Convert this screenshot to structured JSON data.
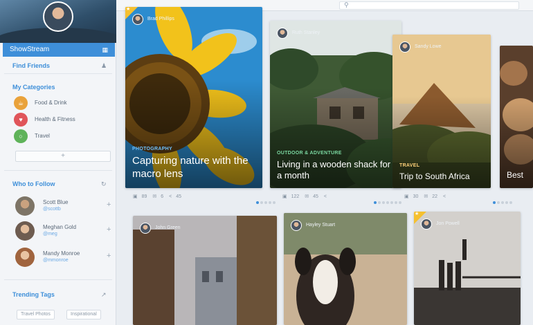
{
  "sidebar": {
    "stream_label": "ShowStream",
    "find_friends": "Find Friends",
    "my_categories": "My Categories",
    "categories": [
      {
        "label": "Food & Drink",
        "icon": "food-icon",
        "color": "#e9a23b"
      },
      {
        "label": "Health & Fitness",
        "icon": "heart-icon",
        "color": "#e0555a"
      },
      {
        "label": "Travel",
        "icon": "globe-icon",
        "color": "#5fb35a"
      }
    ],
    "add_label": "+",
    "who_to_follow": "Who to Follow",
    "follow": [
      {
        "name": "Scott Blue",
        "handle": "@scottb"
      },
      {
        "name": "Meghan Gold",
        "handle": "@meg"
      },
      {
        "name": "Mandy Monroe",
        "handle": "@mmonroe"
      }
    ],
    "trending_tags": "Trending Tags",
    "tags": [
      "Travel Photos",
      "Inspirational"
    ]
  },
  "search": {
    "placeholder": ""
  },
  "cards": [
    {
      "author": "Brad Phillips",
      "category": "PHOTOGRAPHY",
      "title": "Capturing nature with the macro lens",
      "stats": {
        "likes": "89",
        "comments": "6",
        "shares": "45"
      },
      "category_color": "#6fc2ff"
    },
    {
      "author": "Ruth Stanley",
      "category": "OUTDOOR & ADVENTURE",
      "title": "Living in a wooden shack for a month",
      "stats": {
        "likes": "122",
        "comments": "45",
        "shares": ""
      },
      "category_color": "#7ad7a0"
    },
    {
      "author": "Sandy Lowe",
      "category": "TRAVEL",
      "title": "Trip to South Africa",
      "stats": {
        "likes": "30",
        "comments": "22",
        "shares": ""
      },
      "category_color": "#ffd27a"
    },
    {
      "author": "",
      "category": "",
      "title": "Best",
      "stats": {},
      "category_color": "#ffffff"
    },
    {
      "author": "John Green",
      "category": "",
      "title": ""
    },
    {
      "author": "Hayley Stuart",
      "category": "",
      "title": ""
    },
    {
      "author": "Jon Powell",
      "category": "",
      "title": ""
    }
  ],
  "colors": {
    "accent": "#3e8fd9",
    "featured": "#f5c02f"
  }
}
